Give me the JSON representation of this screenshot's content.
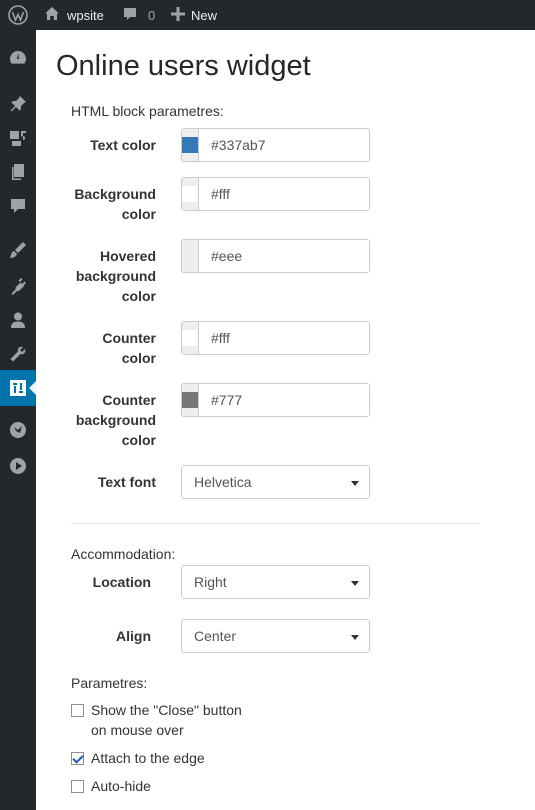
{
  "adminbar": {
    "site_name": "wpsite",
    "comments_count": "0",
    "new_label": "New"
  },
  "sidebar": {
    "items": [
      {
        "icon": "dashboard-icon"
      },
      {
        "icon": "pin-icon"
      },
      {
        "icon": "media-icon"
      },
      {
        "icon": "pages-icon"
      },
      {
        "icon": "comments-icon"
      },
      {
        "icon": "appearance-icon"
      },
      {
        "icon": "plugins-icon"
      },
      {
        "icon": "users-icon"
      },
      {
        "icon": "tools-icon"
      },
      {
        "icon": "settings-icon",
        "active": true
      },
      {
        "icon": "extension-icon"
      },
      {
        "icon": "play-icon"
      }
    ]
  },
  "page": {
    "title": "Online users widget",
    "html_block_label": "HTML block parametres:",
    "accommodation_label": "Accommodation:",
    "parametres_label": "Parametres:"
  },
  "colors": {
    "text_color": {
      "label": "Text color",
      "value": "#337ab7",
      "swatch": "#337ab7"
    },
    "background_color": {
      "label_1": "Background",
      "label_2": "color",
      "value": "#fff",
      "swatch": "#ffffff"
    },
    "hovered_background_color": {
      "label_1": "Hovered",
      "label_2": "background",
      "label_3": "color",
      "value": "#eee",
      "swatch": "#eeeeee"
    },
    "counter_color": {
      "label_1": "Counter",
      "label_2": "color",
      "value": "#fff",
      "swatch": "#ffffff"
    },
    "counter_background_color": {
      "label_1": "Counter",
      "label_2": "background",
      "label_3": "color",
      "value": "#777",
      "swatch": "#777777"
    }
  },
  "text_font": {
    "label": "Text font",
    "value": "Helvetica"
  },
  "location": {
    "label": "Location",
    "value": "Right"
  },
  "align": {
    "label": "Align",
    "value": "Center"
  },
  "checkboxes": {
    "show_close": {
      "label_1": "Show the \"Close\" button",
      "label_2": "on mouse over",
      "checked": false
    },
    "attach_edge": {
      "label": "Attach to the edge",
      "checked": true
    },
    "auto_hide": {
      "label": "Auto-hide",
      "checked": false
    }
  }
}
